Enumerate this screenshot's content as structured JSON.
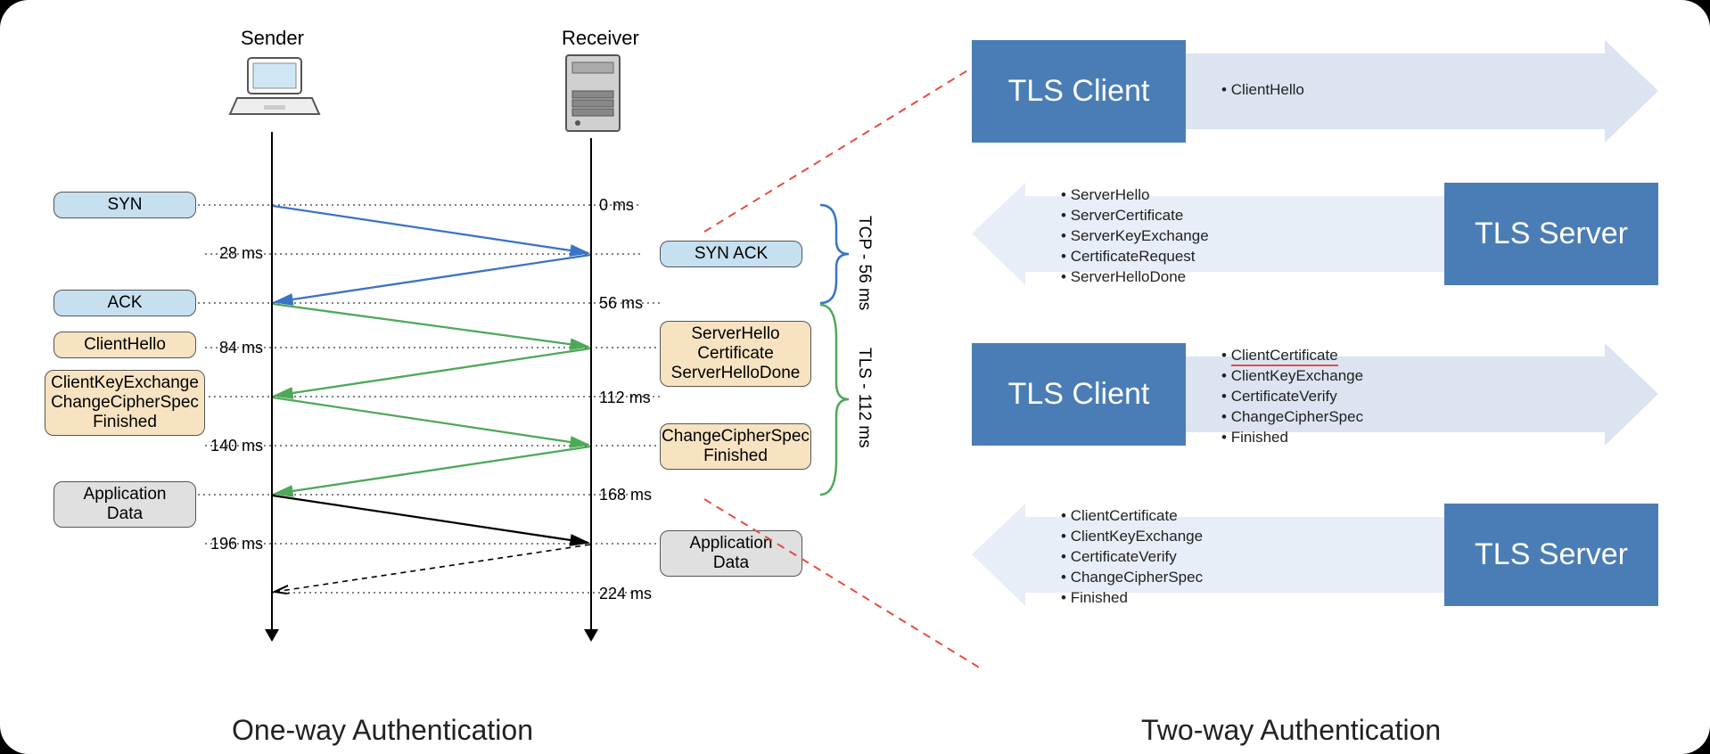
{
  "captions": {
    "left": "One-way Authentication",
    "right": "Two-way Authentication"
  },
  "seq": {
    "sender": "Sender",
    "receiver": "Receiver",
    "left_msgs": {
      "syn": "SYN",
      "ack": "ACK",
      "clienthello": "ClientHello",
      "cke_l1": "ClientKeyExchange",
      "cke_l2": "ChangeCipherSpec",
      "cke_l3": "Finished",
      "appdata": "Application Data"
    },
    "right_msgs": {
      "synack": "SYN ACK",
      "sh_l1": "ServerHello",
      "sh_l2": "Certificate",
      "sh_l3": "ServerHelloDone",
      "ccs_l1": "ChangeCipherSpec",
      "ccs_l2": "Finished",
      "appdata": "Application Data"
    },
    "times_left": {
      "t28": "28 ms",
      "t84": "84 ms",
      "t140": "140 ms",
      "t196": "196 ms"
    },
    "times_right": {
      "t0": "0 ms",
      "t56": "56 ms",
      "t112": "112 ms",
      "t168": "168 ms",
      "t224": "224 ms"
    },
    "brackets": {
      "tcp": "TCP - 56 ms",
      "tls": "TLS - 112 ms"
    }
  },
  "flows": {
    "client": "TLS Client",
    "server": "TLS Server",
    "row1": [
      "ClientHello"
    ],
    "row2": [
      "ServerHello",
      "ServerCertificate",
      "ServerKeyExchange",
      "CertificateRequest",
      "ServerHelloDone"
    ],
    "row3": [
      "ClientCertificate",
      "ClientKeyExchange",
      "CertificateVerify",
      "ChangeCipherSpec",
      "Finished"
    ],
    "row3_highlight_index": 0,
    "row4": [
      "ClientCertificate",
      "ClientKeyExchange",
      "CertificateVerify",
      "ChangeCipherSpec",
      "Finished"
    ]
  }
}
